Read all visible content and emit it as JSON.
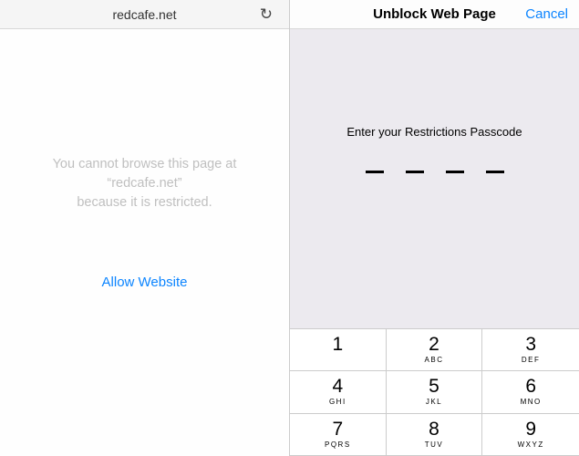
{
  "left": {
    "url": "redcafe.net",
    "restriction_line1": "You cannot browse this page at",
    "restriction_line2": "“redcafe.net”",
    "restriction_line3": "because it is restricted.",
    "allow_label": "Allow Website"
  },
  "right": {
    "title": "Unblock Web Page",
    "cancel": "Cancel",
    "prompt": "Enter your Restrictions Passcode"
  },
  "keypad": [
    {
      "num": "1",
      "letters": ""
    },
    {
      "num": "2",
      "letters": "ABC"
    },
    {
      "num": "3",
      "letters": "DEF"
    },
    {
      "num": "4",
      "letters": "GHI"
    },
    {
      "num": "5",
      "letters": "JKL"
    },
    {
      "num": "6",
      "letters": "MNO"
    },
    {
      "num": "7",
      "letters": "PQRS"
    },
    {
      "num": "8",
      "letters": "TUV"
    },
    {
      "num": "9",
      "letters": "WXYZ"
    }
  ]
}
